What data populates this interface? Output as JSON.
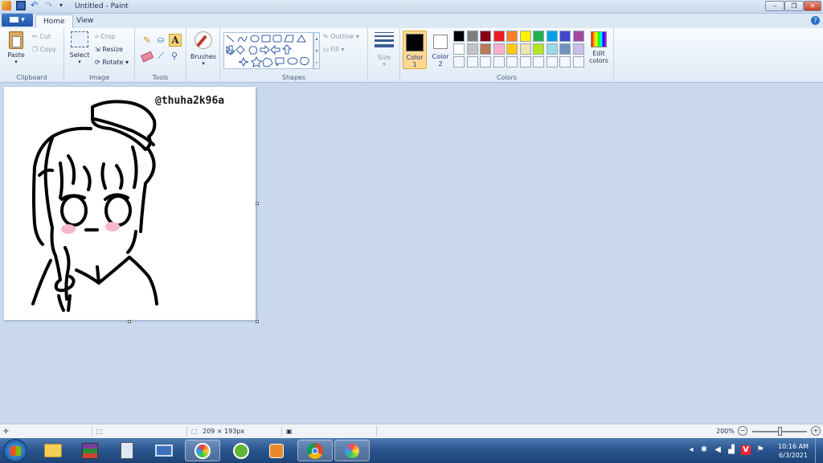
{
  "window": {
    "title": "Untitled - Paint"
  },
  "tabs": {
    "file": "▾",
    "home": "Home",
    "view": "View"
  },
  "clipboard": {
    "paste": "Paste",
    "cut": "Cut",
    "copy": "Copy",
    "label": "Clipboard"
  },
  "image": {
    "select": "Select",
    "crop": "Crop",
    "resize": "Resize",
    "rotate": "Rotate",
    "label": "Image"
  },
  "tools": {
    "label": "Tools"
  },
  "brushes": {
    "label": "Brushes"
  },
  "shapes": {
    "outline": "Outline",
    "fill": "Fill",
    "label": "Shapes"
  },
  "size": {
    "label": "Size"
  },
  "colors": {
    "color1": "Color 1",
    "color2": "Color 2",
    "edit": "Edit colors",
    "label": "Colors",
    "color1_value": "#000000",
    "color2_value": "#ffffff",
    "palette_row1": [
      "#000000",
      "#7f7f7f",
      "#880015",
      "#ed1c24",
      "#ff7f27",
      "#fff200",
      "#22b14c",
      "#00a2e8",
      "#3f48cc",
      "#a349a4"
    ],
    "palette_row2": [
      "#ffffff",
      "#c3c3c3",
      "#b97a57",
      "#ffaec9",
      "#ffc90e",
      "#efe4b0",
      "#b5e61d",
      "#99d9ea",
      "#7092be",
      "#c8bfe7"
    ]
  },
  "canvas": {
    "watermark": "@thuha2k96a"
  },
  "status": {
    "dimensions": "209 × 193px",
    "zoom": "200%"
  },
  "clock": {
    "time": "10:16 AM",
    "date": "6/3/2021"
  }
}
